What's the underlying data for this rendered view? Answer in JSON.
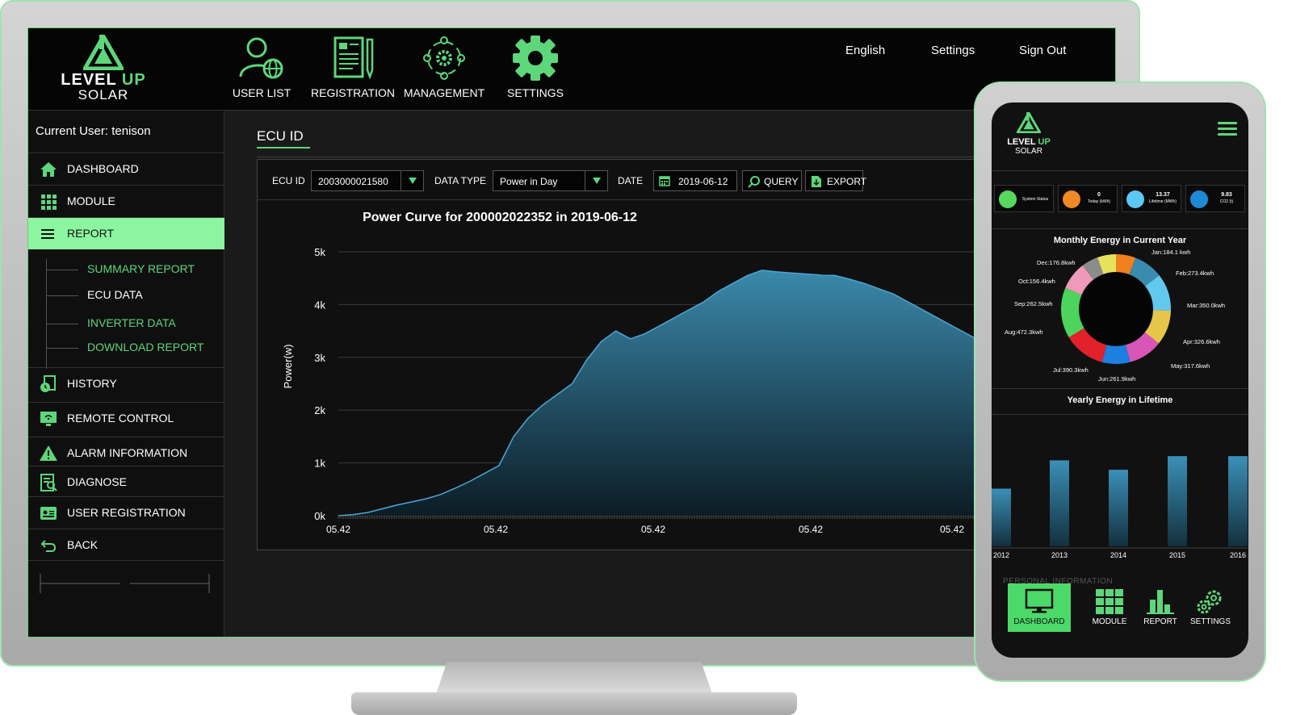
{
  "brand": {
    "line1_a": "LEVEL",
    "line1_b": "UP",
    "line2": "SOLAR"
  },
  "top_nav": [
    {
      "label": "USER LIST",
      "icon": "user-globe-icon"
    },
    {
      "label": "REGISTRATION",
      "icon": "document-pen-icon"
    },
    {
      "label": "MANAGEMENT",
      "icon": "team-gear-icon"
    },
    {
      "label": "SETTINGS",
      "icon": "gear-icon"
    }
  ],
  "top_links": {
    "language": "English",
    "settings": "Settings",
    "sign_out": "Sign Out"
  },
  "sidebar": {
    "current_user": "Current User: tenison",
    "items": [
      {
        "label": "DASHBOARD",
        "icon": "home-icon"
      },
      {
        "label": "MODULE",
        "icon": "grid-icon"
      },
      {
        "label": "REPORT",
        "icon": "menu-lines-icon"
      },
      {
        "label": "HISTORY",
        "icon": "history-icon"
      },
      {
        "label": "REMOTE CONTROL",
        "icon": "monitor-wifi-icon"
      },
      {
        "label": "ALARM INFORMATION",
        "icon": "alert-icon"
      },
      {
        "label": "DIAGNOSE",
        "icon": "clipboard-search-icon"
      },
      {
        "label": "USER REGISTRATION",
        "icon": "id-card-icon"
      },
      {
        "label": "BACK",
        "icon": "back-arrow-icon"
      }
    ],
    "report_sub": [
      "SUMMARY REPORT",
      "ECU DATA",
      "INVERTER DATA",
      "DOWNLOAD REPORT"
    ]
  },
  "content": {
    "title": "ECU ID",
    "toolbar": {
      "ecu_label": "ECU ID",
      "ecu_value": "2003000021580",
      "type_label": "DATA TYPE",
      "type_value": "Power in Day",
      "date_label": "DATE",
      "date_value": "2019-06-12",
      "query": "QUERY",
      "export": "EXPORT"
    }
  },
  "colors": {
    "accent": "#5ed67a",
    "active_bg": "#8cf5a0",
    "curve_stroke": "#4aa8d8"
  },
  "chart_data": {
    "type": "area",
    "title": "Power Curve for 200002022352 in 2019-06-12",
    "ylabel": "Power(w)",
    "xlabel": "",
    "ylim": [
      0,
      5000
    ],
    "yticks": [
      "0k",
      "1k",
      "2k",
      "3k",
      "4k",
      "5k"
    ],
    "xticks": [
      "05.42",
      "05.42",
      "05.42",
      "05.42",
      "05.42"
    ],
    "values": [
      0,
      20,
      60,
      130,
      200,
      260,
      320,
      400,
      520,
      650,
      800,
      950,
      1500,
      1850,
      2100,
      2300,
      2500,
      2950,
      3300,
      3500,
      3350,
      3450,
      3600,
      3750,
      3900,
      4050,
      4250,
      4400,
      4550,
      4650,
      4620,
      4600,
      4580,
      4560,
      4550,
      4480,
      4400,
      4300,
      4200,
      4050,
      3900,
      3750,
      3600,
      3450,
      3300,
      3150,
      3000,
      2800,
      2550,
      2200,
      1700,
      1100,
      900,
      700,
      450,
      200
    ]
  },
  "mobile": {
    "brand": {
      "line1_a": "LEVEL",
      "line1_b": "UP",
      "line2": "SOLAR"
    },
    "stats": [
      {
        "value": "System Status",
        "sub": "",
        "icon": "bulb-icon",
        "color": "#57d85d"
      },
      {
        "value": "0",
        "sub": "Today (kWh)",
        "icon": "sun-icon",
        "color": "#f08a24"
      },
      {
        "value": "13.37",
        "sub": "Lifetime (MWh)",
        "icon": "battery-icon",
        "color": "#5bc8f5"
      },
      {
        "value": "9.83",
        "sub": "CO2 (t)",
        "icon": "co2-icon",
        "color": "#1e8ad6"
      }
    ],
    "monthly_title": "Monthly Energy in Current Year",
    "monthly": [
      {
        "label": "Jan:184.1 kwh",
        "value": 184.1,
        "color": "#f07f1e"
      },
      {
        "label": "Feb:273.4kwh",
        "value": 273.4,
        "color": "#3b8bb0"
      },
      {
        "label": "Mar:350.0kwh",
        "value": 350.0,
        "color": "#62c9ee"
      },
      {
        "label": "Apr:326.6kwh",
        "value": 326.6,
        "color": "#e5c64b"
      },
      {
        "label": "May:317.6kwh",
        "value": 317.6,
        "color": "#d856b8"
      },
      {
        "label": "Jun:261.9kwh",
        "value": 261.9,
        "color": "#1d7fe0"
      },
      {
        "label": "Jul:390.3kwh",
        "value": 390.3,
        "color": "#e3212b"
      },
      {
        "label": "Aug:472.3kwh",
        "value": 472.3,
        "color": "#4cd45c"
      },
      {
        "label": "Sep:262.5kwh",
        "value": 262.5,
        "color": "#ef9ab8"
      },
      {
        "label": "Oct:156.4kwh",
        "value": 156.4,
        "color": "#8c8c8c"
      },
      {
        "label": "Dec:176.8kwh",
        "value": 176.8,
        "color": "#e8e25a"
      }
    ],
    "yearly_title": "Yearly Energy in Lifetime",
    "yearly": {
      "categories": [
        "2012",
        "2013",
        "2014",
        "2015",
        "2016"
      ],
      "values": [
        0.55,
        0.82,
        0.73,
        0.86,
        0.86
      ]
    },
    "personal_info": "PERSONAL INFORMATION",
    "bottom_nav": [
      {
        "label": "DASHBOARD",
        "icon": "monitor-icon"
      },
      {
        "label": "MODULE",
        "icon": "grid-icon"
      },
      {
        "label": "REPORT",
        "icon": "bar-chart-icon"
      },
      {
        "label": "SETTINGS",
        "icon": "gears-icon"
      }
    ]
  }
}
